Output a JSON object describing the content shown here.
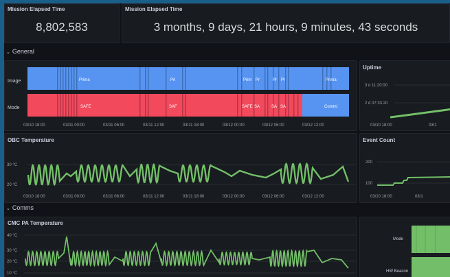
{
  "stat1": {
    "title": "Mission Elapsed Time",
    "value": "8,802,583"
  },
  "stat2": {
    "title": "Mission Elapsed Time",
    "value": "3 months, 9 days, 21 hours, 9 minutes, 43 seconds"
  },
  "rows": {
    "general": "General",
    "comms": "Comms"
  },
  "timeline": {
    "rows": [
      "Image",
      "Mode"
    ],
    "image_labels": [
      "Prima",
      "Pri",
      "Prim",
      "Pr",
      "Pr",
      "Pr",
      "Prima"
    ],
    "mode_labels": [
      "SAFE",
      "SAF",
      "SAFE",
      "SA",
      "SA",
      "SA",
      "Commi"
    ],
    "xticks": [
      "03/10 18:00",
      "03/11 00:00",
      "03/11 06:00",
      "03/11 12:00",
      "03/11 18:00",
      "03/12 00:00",
      "03/12 06:00",
      "03/12 12:00"
    ],
    "colors": {
      "image": "#5794f2",
      "mode_safe": "#f2495c",
      "mode_comm": "#5794f2"
    }
  },
  "uptime": {
    "title": "Uptime",
    "yticks": [
      "3 d 11:20:00",
      "2 d 07:33:20"
    ],
    "xticks": [
      "03/10 18:00",
      "03/1"
    ]
  },
  "obc": {
    "title": "OBC Temperature",
    "yticks": [
      "30 °C",
      "20 °C"
    ],
    "xticks": [
      "03/10 18:00",
      "03/11 00:00",
      "03/11 06:00",
      "03/11 12:00",
      "03/11 18:00",
      "03/12 00:00",
      "03/12 06:00",
      "03/12 12:00"
    ],
    "color": "#73bf69"
  },
  "events": {
    "title": "Event Count",
    "yticks": [
      "200",
      "100"
    ],
    "xticks": [
      "03/10 18:00",
      "03/1"
    ]
  },
  "cmc": {
    "title": "CMC PA Temperature",
    "yticks": [
      "40 °C",
      "30 °C",
      "20 °C",
      "10 °C"
    ],
    "color": "#73bf69"
  },
  "comms_state": {
    "rows": [
      "Mode",
      "HW Beacon"
    ],
    "color": "#73bf69"
  }
}
